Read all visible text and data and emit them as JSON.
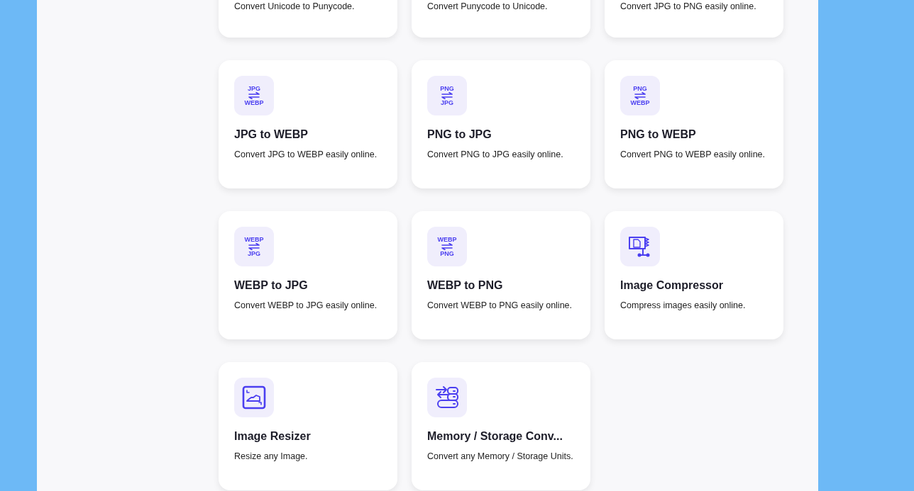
{
  "tools": [
    {
      "description": "Convert Unicode to Punycode."
    },
    {
      "description": "Convert Punycode to Unicode."
    },
    {
      "description": "Convert JPG to PNG easily online."
    },
    {
      "icon": {
        "kind": "formats",
        "from": "JPG",
        "to": "WEBP"
      },
      "title": "JPG to WEBP",
      "description": "Convert JPG to WEBP easily online."
    },
    {
      "icon": {
        "kind": "formats",
        "from": "PNG",
        "to": "JPG"
      },
      "title": "PNG to JPG",
      "description": "Convert PNG to JPG easily online."
    },
    {
      "icon": {
        "kind": "formats",
        "from": "PNG",
        "to": "WEBP"
      },
      "title": "PNG to WEBP",
      "description": "Convert PNG to WEBP easily online."
    },
    {
      "icon": {
        "kind": "formats",
        "from": "WEBP",
        "to": "JPG"
      },
      "title": "WEBP to JPG",
      "description": "Convert WEBP to JPG easily online."
    },
    {
      "icon": {
        "kind": "formats",
        "from": "WEBP",
        "to": "PNG"
      },
      "title": "WEBP to PNG",
      "description": "Convert WEBP to PNG easily online."
    },
    {
      "icon": {
        "kind": "compress"
      },
      "title": "Image Compressor",
      "description": "Compress images easily online."
    },
    {
      "icon": {
        "kind": "resize"
      },
      "title": "Image Resizer",
      "description": "Resize any Image."
    },
    {
      "icon": {
        "kind": "storage"
      },
      "title": "Memory / Storage Conv...",
      "description": "Convert any Memory / Storage Units."
    }
  ]
}
